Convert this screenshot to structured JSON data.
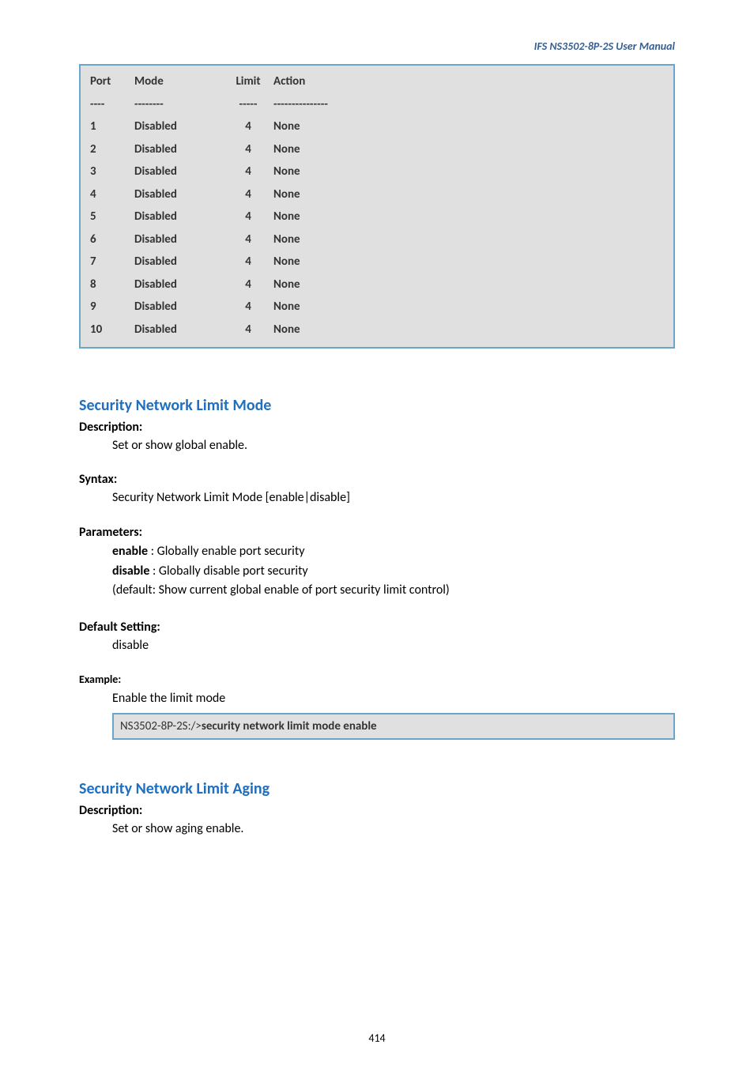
{
  "header": "IFS  NS3502-8P-2S  User  Manual",
  "port_table": {
    "columns": [
      "Port",
      "Mode",
      "Limit",
      "Action"
    ],
    "divider": [
      "----",
      "--------",
      "-----",
      "---------------"
    ],
    "rows": [
      {
        "port": "1",
        "mode": "Disabled",
        "limit": "4",
        "action": "None"
      },
      {
        "port": "2",
        "mode": "Disabled",
        "limit": "4",
        "action": "None"
      },
      {
        "port": "3",
        "mode": "Disabled",
        "limit": "4",
        "action": "None"
      },
      {
        "port": "4",
        "mode": "Disabled",
        "limit": "4",
        "action": "None"
      },
      {
        "port": "5",
        "mode": "Disabled",
        "limit": "4",
        "action": "None"
      },
      {
        "port": "6",
        "mode": "Disabled",
        "limit": "4",
        "action": "None"
      },
      {
        "port": "7",
        "mode": "Disabled",
        "limit": "4",
        "action": "None"
      },
      {
        "port": "8",
        "mode": "Disabled",
        "limit": "4",
        "action": "None"
      },
      {
        "port": "9",
        "mode": "Disabled",
        "limit": "4",
        "action": "None"
      },
      {
        "port": "10",
        "mode": "Disabled",
        "limit": "4",
        "action": "None"
      }
    ]
  },
  "section1": {
    "title": "Security Network Limit Mode",
    "desc_label": "Description:",
    "desc_text": "Set or show global enable.",
    "syntax_label": "Syntax:",
    "syntax_text": "Security Network Limit Mode [enable|disable]",
    "params_label": "Parameters:",
    "param_enable_key": "enable",
    "param_enable_text": " : Globally enable port security",
    "param_disable_key": "disable",
    "param_disable_text": " : Globally disable port security",
    "param_default": "(default: Show current global enable of port security limit control)",
    "default_label": "Default Setting:",
    "default_text": "disable",
    "example_label": "Example:",
    "example_text": "Enable the limit mode",
    "cli_prompt": "NS3502-8P-2S:/>",
    "cli_cmd": "security network limit mode enable"
  },
  "section2": {
    "title": "Security Network Limit Aging",
    "desc_label": "Description:",
    "desc_text": "Set or show aging enable."
  },
  "page_number": "414"
}
